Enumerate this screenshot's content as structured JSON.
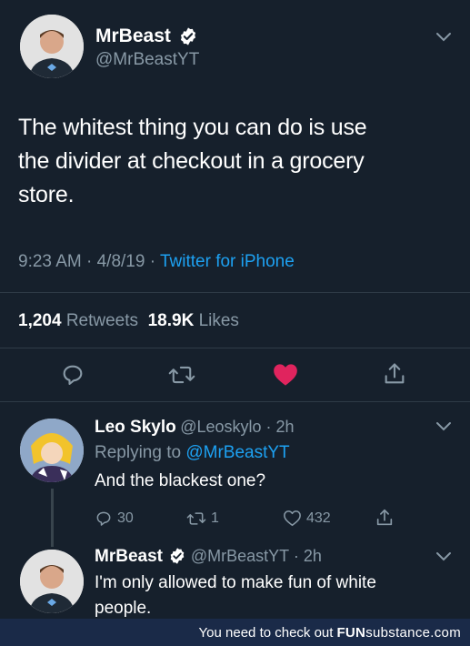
{
  "main_tweet": {
    "name": "MrBeast",
    "handle": "@MrBeastYT",
    "text_lines": [
      "The whitest thing you can do is use",
      "the divider at checkout in a grocery",
      "store."
    ],
    "time": "9:23 AM · 4/8/19 · ",
    "source": "Twitter for iPhone",
    "retweets_count": "1,204",
    "retweets_label": "Retweets",
    "likes_count": "18.9K",
    "likes_label": "Likes"
  },
  "reply_1": {
    "name": "Leo Skylo",
    "handle_time": "@Leoskylo · 2h",
    "replying_prefix": "Replying to ",
    "replying_to": "@MrBeastYT",
    "text": "And the blackest one?",
    "replies": "30",
    "retweets": "1",
    "likes": "432"
  },
  "reply_2": {
    "name": "MrBeast",
    "handle_time": "@MrBeastYT · 2h",
    "text_lines": [
      "I'm only allowed to make fun of white",
      "people."
    ]
  },
  "footer": {
    "text": "You need to check out",
    "brand_a": "FUN",
    "brand_b": "substance",
    "brand_c": ".com"
  },
  "colors": {
    "background": "#16202c",
    "accent": "#1da1f2",
    "like_active": "#e0245e",
    "muted": "#8899a6"
  },
  "icons": [
    "chevron-down-icon",
    "verified-badge-icon",
    "reply-icon",
    "retweet-icon",
    "heart-icon",
    "share-icon"
  ]
}
